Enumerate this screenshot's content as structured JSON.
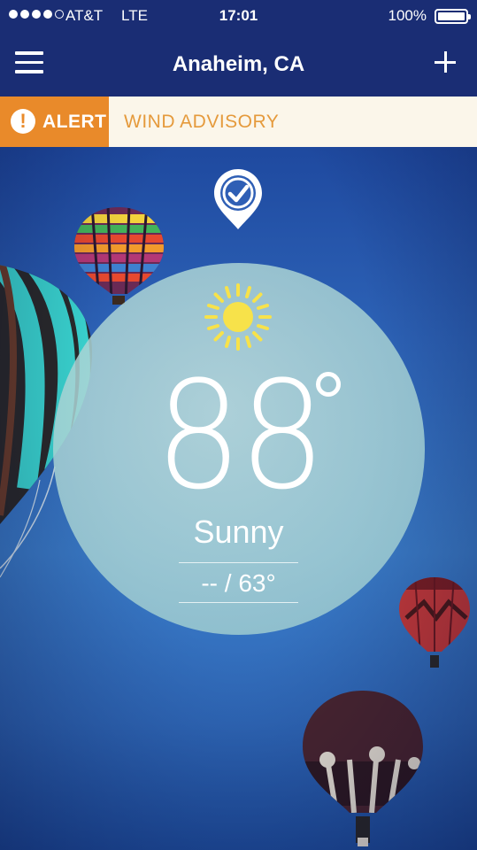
{
  "status_bar": {
    "carrier": "AT&T",
    "network": "LTE",
    "time": "17:01",
    "battery": "100%",
    "signal_bars": 4
  },
  "nav": {
    "title": "Anaheim, CA",
    "menu_icon": "hamburger-menu-icon",
    "add_icon": "plus-icon"
  },
  "alert": {
    "tag": "ALERT",
    "icon": "exclamation-icon",
    "text": "WIND ADVISORY",
    "color": "#e98a2a"
  },
  "location": {
    "icon": "location-check-icon"
  },
  "weather": {
    "icon": "sun-icon",
    "temperature": "88",
    "condition": "Sunny",
    "hi_lo": "-- / 63°"
  },
  "colors": {
    "bar_background": "#1a2d74",
    "alert_orange": "#e98a2a",
    "sun_yellow": "#f7e24a"
  }
}
